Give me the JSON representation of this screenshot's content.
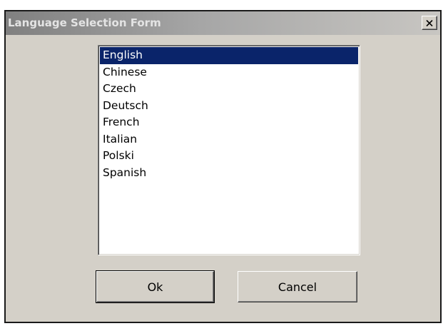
{
  "window": {
    "title": "Language Selection Form"
  },
  "language_list": {
    "selected": "English",
    "items": [
      {
        "label": "English",
        "selected": true
      },
      {
        "label": "Chinese",
        "selected": false
      },
      {
        "label": "Czech",
        "selected": false
      },
      {
        "label": "Deutsch",
        "selected": false
      },
      {
        "label": "French",
        "selected": false
      },
      {
        "label": "Italian",
        "selected": false
      },
      {
        "label": "Polski",
        "selected": false
      },
      {
        "label": "Spanish",
        "selected": false
      }
    ]
  },
  "buttons": {
    "ok_label": "Ok",
    "cancel_label": "Cancel"
  },
  "icons": {
    "close": "close-icon"
  },
  "colors": {
    "selection_highlight": "#0a246a",
    "dialog_background": "#d4d0c8"
  }
}
